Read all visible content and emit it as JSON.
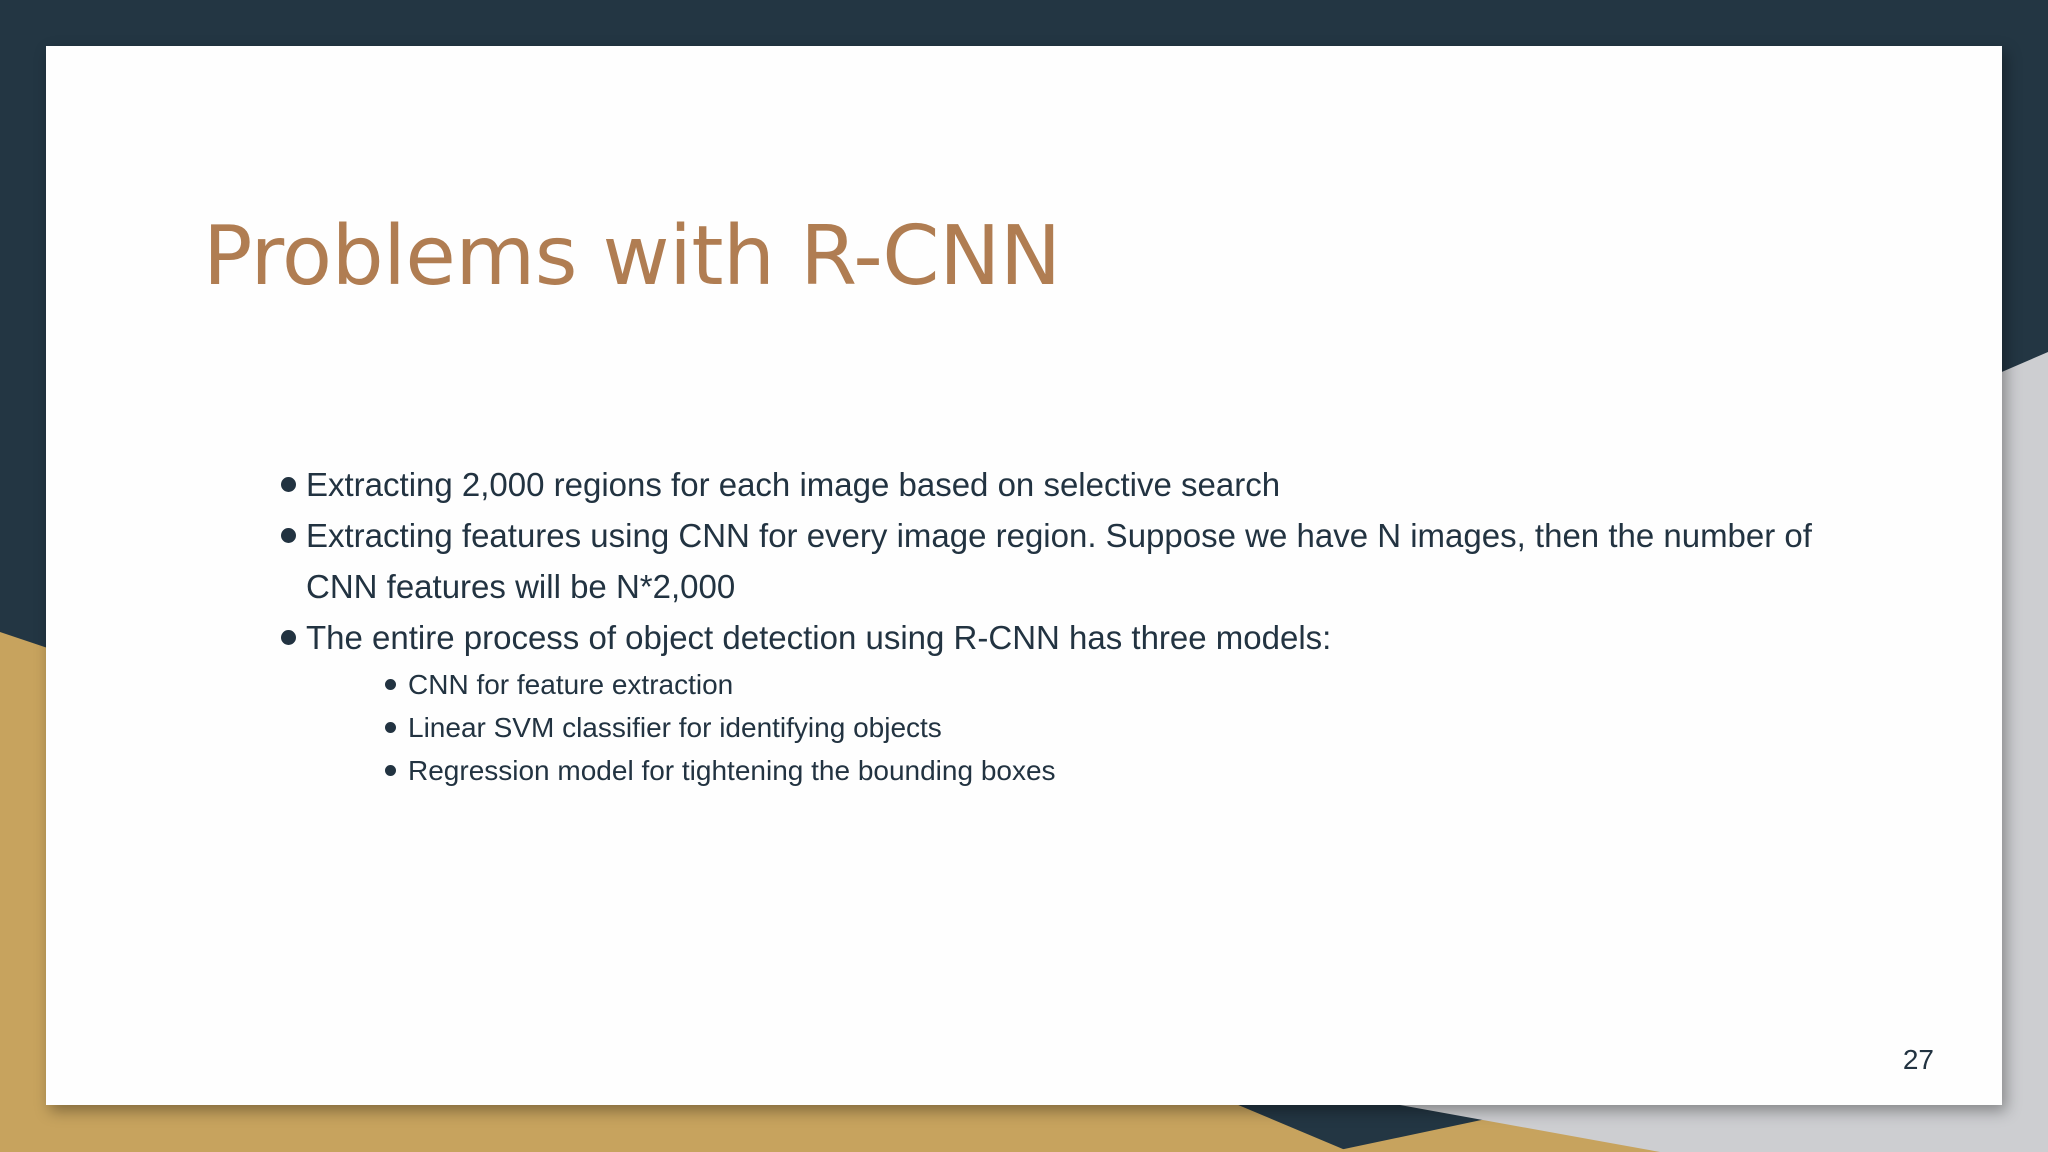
{
  "slide": {
    "title": "Problems with R-CNN",
    "bullets": [
      {
        "text": "Extracting 2,000 regions for each image based on selective search"
      },
      {
        "text": "Extracting features using CNN for every image region. Suppose we have N images, then the number of CNN features will be N*2,000"
      },
      {
        "text": "The entire process of object detection using R-CNN has three models:",
        "sub": [
          "CNN for feature extraction",
          "Linear SVM classifier for identifying objects",
          "Regression model for tightening the bounding boxes"
        ]
      }
    ],
    "page_number": "27"
  },
  "theme": {
    "background_dark": "#233643",
    "accent_gold": "#c7a35e",
    "accent_gray": "#cdced1",
    "title_color": "#b07d52",
    "text_color": "#223341"
  }
}
